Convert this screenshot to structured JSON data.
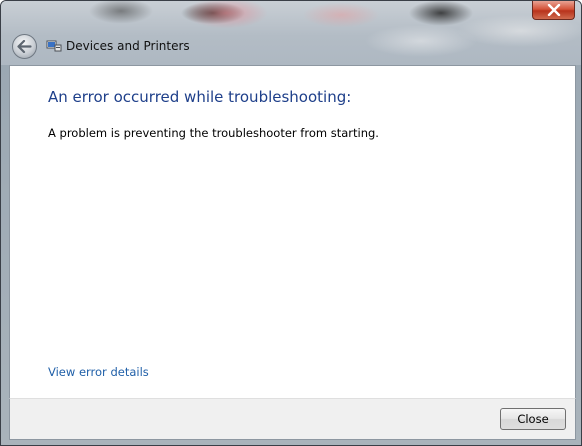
{
  "window": {
    "breadcrumb": "Devices and Printers"
  },
  "content": {
    "heading": "An error occurred while troubleshooting:",
    "message": "A problem is preventing the troubleshooter from starting.",
    "details_link": "View error details"
  },
  "footer": {
    "close_label": "Close"
  },
  "icons": {
    "back": "back-arrow-icon",
    "breadcrumb": "devices-printers-icon",
    "window_close": "close-icon"
  },
  "colors": {
    "heading": "#1e3f8a",
    "link": "#1f5fa8",
    "window_close": "#c7432a"
  }
}
